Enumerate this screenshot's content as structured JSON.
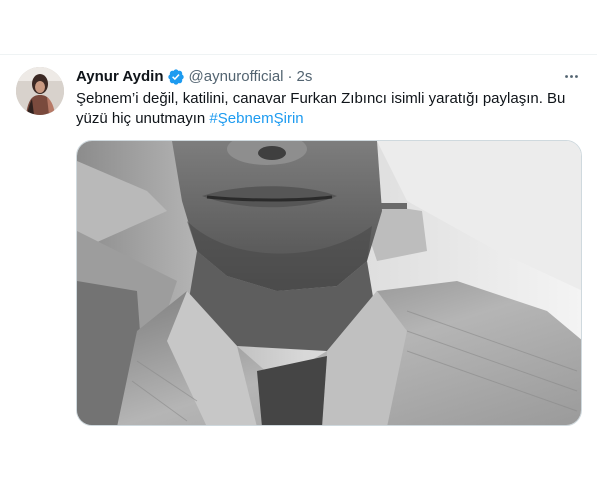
{
  "tweet": {
    "author": {
      "name": "Aynur Aydin",
      "handle": "@aynurofficial",
      "verified": true,
      "avatar_icon": "profile-photo"
    },
    "separator": "·",
    "time": "2s",
    "text_main": "Şebnem’i değil, katilini, canavar Furkan Zıbıncı isimli yaratığı paylaşın. Bu yüzü hiç unutmayın ",
    "hashtag": "#ŞebnemŞirin",
    "more_icon": "more-horizontal-icon",
    "media": {
      "description_icon": "black-and-white-photo",
      "photo_type": "grayscale selfie"
    }
  },
  "colors": {
    "link": "#1d9bf0",
    "secondary_text": "#536471",
    "primary_text": "#0f1419",
    "border": "#cfd9de",
    "verified_badge": "#1d9bf0"
  }
}
